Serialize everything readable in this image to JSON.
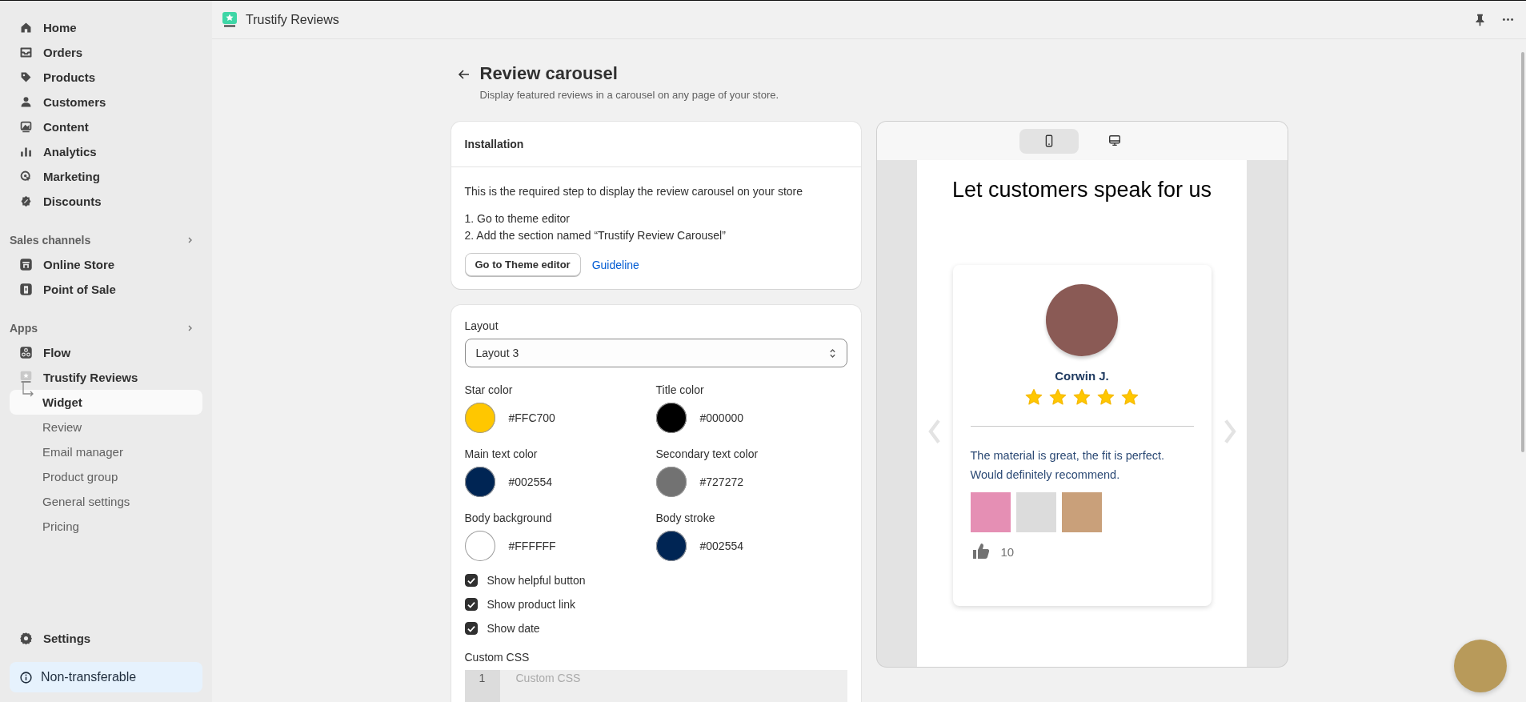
{
  "top_bar": {
    "app_name": "Trustify Reviews"
  },
  "sidebar": {
    "items": [
      {
        "label": "Home",
        "selected": false
      },
      {
        "label": "Orders",
        "selected": false
      },
      {
        "label": "Products",
        "selected": false
      },
      {
        "label": "Customers",
        "selected": false
      },
      {
        "label": "Content",
        "selected": false
      },
      {
        "label": "Analytics",
        "selected": false
      },
      {
        "label": "Marketing",
        "selected": false
      },
      {
        "label": "Discounts",
        "selected": false
      }
    ],
    "sections": [
      {
        "title": "Sales channels",
        "items": [
          {
            "label": "Online Store",
            "selected": false
          },
          {
            "label": "Point of Sale",
            "selected": false
          }
        ]
      },
      {
        "title": "Apps",
        "items": [
          {
            "label": "Flow",
            "selected": false
          },
          {
            "label": "Trustify Reviews",
            "selected": false,
            "children": [
              {
                "label": "Widget",
                "selected": true
              },
              {
                "label": "Review",
                "selected": false
              },
              {
                "label": "Email manager",
                "selected": false
              },
              {
                "label": "Product group",
                "selected": false
              },
              {
                "label": "General settings",
                "selected": false
              },
              {
                "label": "Pricing",
                "selected": false
              }
            ]
          }
        ]
      }
    ],
    "settings": "Settings",
    "notice": "Non-transferable"
  },
  "page": {
    "title": "Review carousel",
    "subtitle": "Display featured reviews in a carousel on any page of your store."
  },
  "installation": {
    "title": "Installation",
    "intro": "This is the required step to display the review carousel on your store",
    "steps": [
      "1. Go to theme editor",
      "2. Add the section named “Trustify Review Carousel”"
    ],
    "button": "Go to Theme editor",
    "link": "Guideline"
  },
  "settings_form": {
    "layout_label": "Layout",
    "layout_value": "Layout 3",
    "colors": [
      {
        "label": "Star color",
        "value": "#FFC700",
        "color": "#ffc700"
      },
      {
        "label": "Title color",
        "value": "#000000",
        "color": "#000000"
      },
      {
        "label": "Main text color",
        "value": "#002554",
        "color": "#002554"
      },
      {
        "label": "Secondary text color",
        "value": "#727272",
        "color": "#727272"
      },
      {
        "label": "Body background",
        "value": "#FFFFFF",
        "color": "#ffffff"
      },
      {
        "label": "Body stroke",
        "value": "#002554",
        "color": "#002554"
      }
    ],
    "checkboxes": [
      {
        "label": "Show helpful button",
        "checked": true
      },
      {
        "label": "Show product link",
        "checked": true
      },
      {
        "label": "Show date",
        "checked": true
      }
    ],
    "custom_css": {
      "label": "Custom CSS",
      "line_number": "1",
      "placeholder": "Custom CSS"
    }
  },
  "preview": {
    "devices": [
      {
        "selected": true
      },
      {
        "selected": false
      }
    ],
    "heading": "Let customers speak for us",
    "review": {
      "name": "Corwin J.",
      "stars": 5,
      "text": "The material is great, the fit is perfect. Would definitely recommend.",
      "helpful_count": "10"
    }
  }
}
